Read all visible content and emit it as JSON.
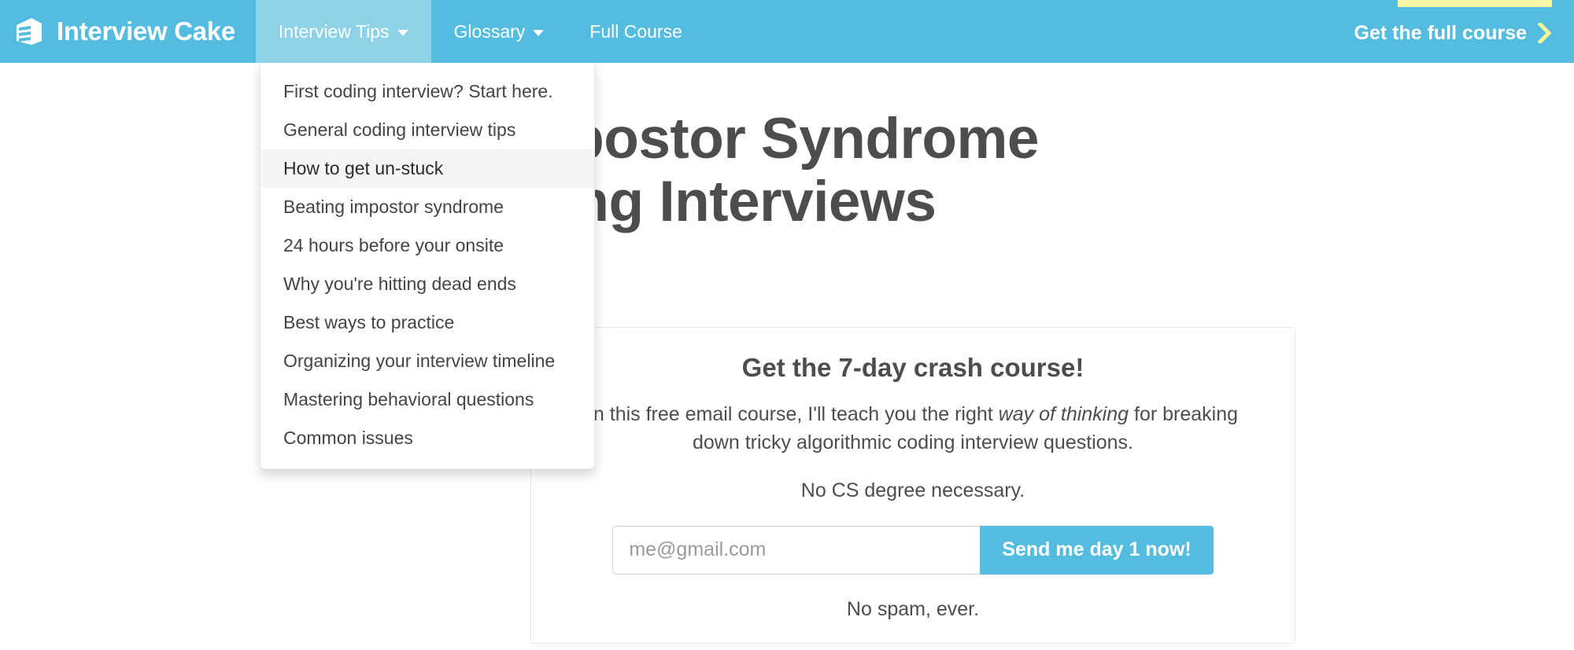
{
  "colors": {
    "navbar_blue": "#54bcdf",
    "navbar_active_blue": "#8ed2e8",
    "accent_yellow": "#f8f7a6",
    "heading_gray": "#4d4d4d",
    "dropdown_hover": "#f5f5f5"
  },
  "navbar": {
    "brand": {
      "label": "Interview Cake",
      "icon": "cake-slice-icon"
    },
    "items": [
      {
        "label": "Interview Tips",
        "has_caret": true,
        "active": true
      },
      {
        "label": "Glossary",
        "has_caret": true,
        "active": false
      },
      {
        "label": "Full Course",
        "has_caret": false,
        "active": false
      }
    ],
    "cta": {
      "label": "Get the full course",
      "icon": "chevron-right-icon"
    }
  },
  "dropdown": {
    "owner": "Interview Tips",
    "items": [
      {
        "label": "First coding interview? Start here.",
        "hovered": false
      },
      {
        "label": "General coding interview tips",
        "hovered": false
      },
      {
        "label": "How to get un-stuck",
        "hovered": true
      },
      {
        "label": "Beating impostor syndrome",
        "hovered": false
      },
      {
        "label": "24 hours before your onsite",
        "hovered": false
      },
      {
        "label": "Why you're hitting dead ends",
        "hovered": false
      },
      {
        "label": "Best ways to practice",
        "hovered": false
      },
      {
        "label": "Organizing your interview timeline",
        "hovered": false
      },
      {
        "label": "Mastering behavioral questions",
        "hovered": false
      },
      {
        "label": "Common issues",
        "hovered": false
      }
    ]
  },
  "main": {
    "title_line_1": "Beating Impostor Syndrome",
    "title_line_2": "in Coding Interviews"
  },
  "signup": {
    "heading": "Get the 7-day crash course!",
    "body_before_em": "In this free email course, I'll teach you the right ",
    "body_em": "way of thinking",
    "body_after_em": " for breaking down tricky algorithmic coding interview questions.",
    "subline": "No CS degree necessary.",
    "email_placeholder": "me@gmail.com",
    "email_value": "",
    "submit_label": "Send me day 1 now!",
    "no_spam": "No spam, ever."
  }
}
